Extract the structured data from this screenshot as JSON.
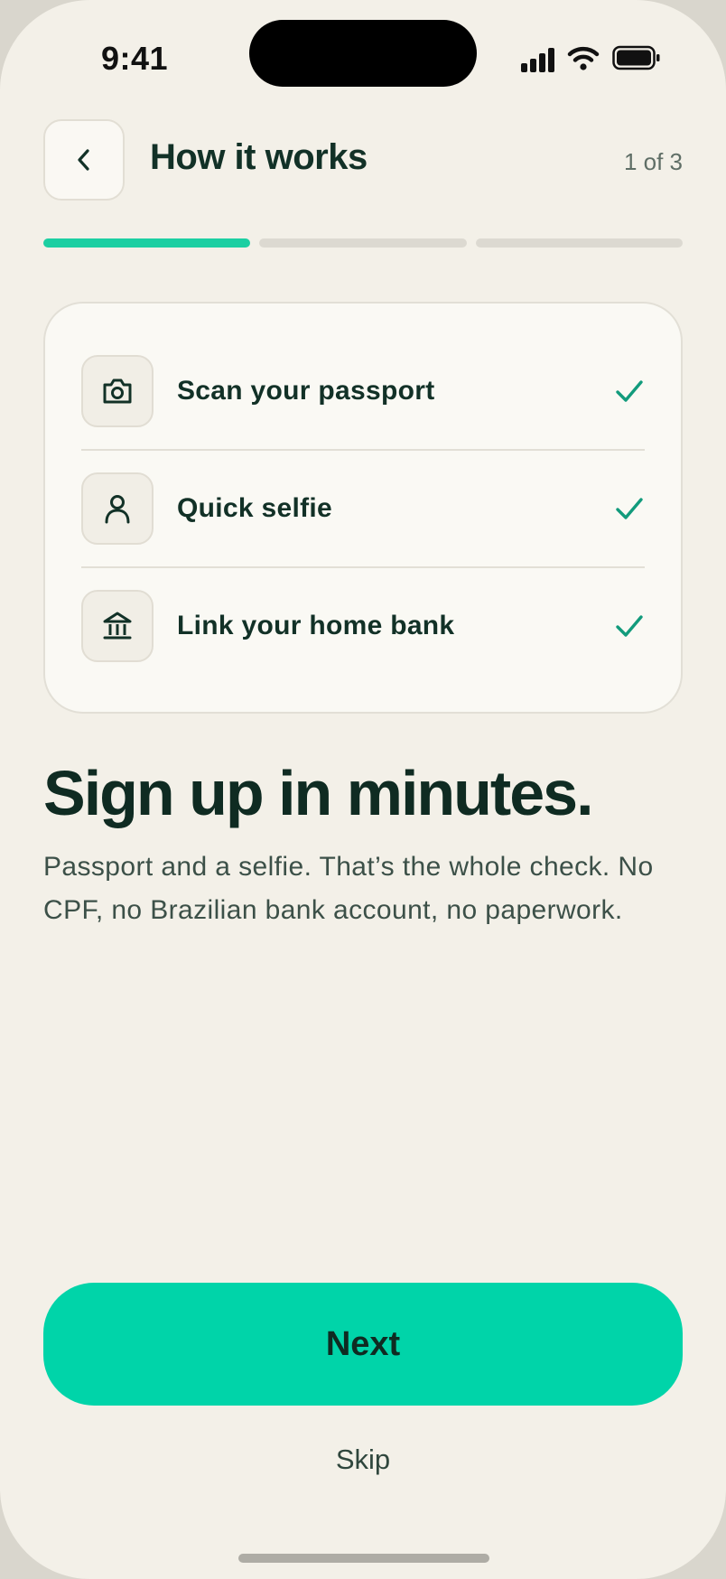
{
  "status_bar": {
    "time": "9:41"
  },
  "header": {
    "back_icon": "chevron-left-icon",
    "title": "How it works",
    "step_label": "1 of 3"
  },
  "progress": {
    "current_step": 1,
    "total_steps": 3
  },
  "steps_card": {
    "items": [
      {
        "icon": "camera-icon",
        "label": "Scan your passport",
        "done": true
      },
      {
        "icon": "person-icon",
        "label": "Quick selfie",
        "done": true
      },
      {
        "icon": "bank-icon",
        "label": "Link your home bank",
        "done": true
      }
    ]
  },
  "content": {
    "headline": "Sign up in minutes.",
    "body": "Passport and a selfie. That’s the whole check. No CPF, no Brazilian bank account, no paperwork."
  },
  "actions": {
    "next_label": "Next",
    "skip_label": "Skip"
  },
  "colors": {
    "accent": "#00d4a9",
    "background": "#f3f0e8",
    "text_dark": "#123127",
    "check": "#129b7c"
  }
}
